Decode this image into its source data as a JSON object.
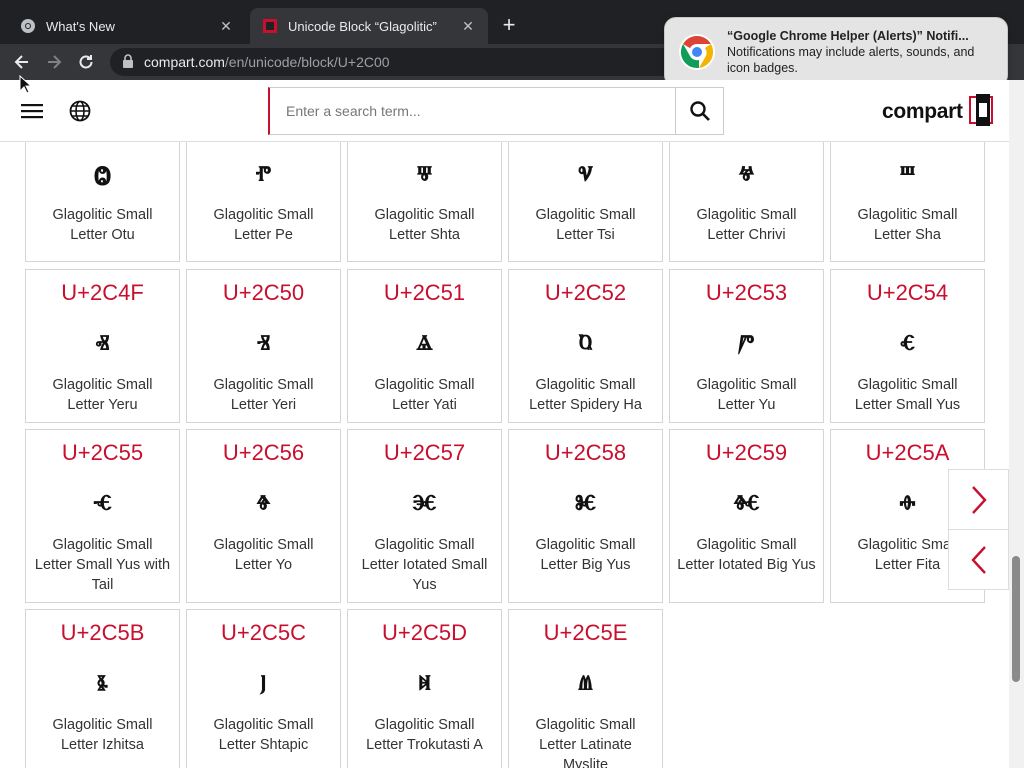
{
  "browser": {
    "tabs": [
      {
        "label": "What's New",
        "close": "✕"
      },
      {
        "label": "Unicode Block “Glagolitic”",
        "close": "✕"
      }
    ],
    "newtab": "+",
    "url_host": "compart.com",
    "url_path": "/en/unicode/block/U+2C00"
  },
  "notification": {
    "title": "“Google Chrome Helper (Alerts)” Notifi...",
    "body": "Notifications may include alerts, sounds, and icon badges."
  },
  "site": {
    "search_placeholder": "Enter a search term...",
    "logo_text": "compart"
  },
  "colors": {
    "accent": "#c8102e",
    "chrome_dark": "#202124",
    "chrome_toolbar": "#35363a"
  },
  "grid": {
    "row0": [
      {
        "code": "",
        "glyph": "Ⱉ",
        "name": "Glagolitic Small Letter Otu"
      },
      {
        "code": "",
        "glyph": "ⱂ",
        "name": "Glagolitic Small Letter Pe"
      },
      {
        "code": "",
        "glyph": "ⱋ",
        "name": "Glagolitic Small Letter Shta"
      },
      {
        "code": "",
        "glyph": "ⱌ",
        "name": "Glagolitic Small Letter Tsi"
      },
      {
        "code": "",
        "glyph": "ⱍ",
        "name": "Glagolitic Small Letter Chrivi"
      },
      {
        "code": "",
        "glyph": "ⱎ",
        "name": "Glagolitic Small Letter Sha"
      }
    ],
    "row1": [
      {
        "code": "U+2C4F",
        "glyph": "ⱏ",
        "name": "Glagolitic Small Letter Yeru"
      },
      {
        "code": "U+2C50",
        "glyph": "ⱐ",
        "name": "Glagolitic Small Letter Yeri"
      },
      {
        "code": "U+2C51",
        "glyph": "ⱑ",
        "name": "Glagolitic Small Letter Yati"
      },
      {
        "code": "U+2C52",
        "glyph": "ⱒ",
        "name": "Glagolitic Small Letter Spidery Ha"
      },
      {
        "code": "U+2C53",
        "glyph": "ⱓ",
        "name": "Glagolitic Small Letter Yu"
      },
      {
        "code": "U+2C54",
        "glyph": "ⱔ",
        "name": "Glagolitic Small Letter Small Yus"
      }
    ],
    "row2": [
      {
        "code": "U+2C55",
        "glyph": "ⱕ",
        "name": "Glagolitic Small Letter Small Yus with Tail"
      },
      {
        "code": "U+2C56",
        "glyph": "ⱖ",
        "name": "Glagolitic Small Letter Yo"
      },
      {
        "code": "U+2C57",
        "glyph": "ⱗ",
        "name": "Glagolitic Small Letter Iotated Small Yus"
      },
      {
        "code": "U+2C58",
        "glyph": "ⱘ",
        "name": "Glagolitic Small Letter Big Yus"
      },
      {
        "code": "U+2C59",
        "glyph": "ⱙ",
        "name": "Glagolitic Small Letter Iotated Big Yus"
      },
      {
        "code": "U+2C5A",
        "glyph": "ⱚ",
        "name": "Glagolitic Small Letter Fita"
      }
    ],
    "row3": [
      {
        "code": "U+2C5B",
        "glyph": "ⱛ",
        "name": "Glagolitic Small Letter Izhitsa"
      },
      {
        "code": "U+2C5C",
        "glyph": "ⱜ",
        "name": "Glagolitic Small Letter Shtapic"
      },
      {
        "code": "U+2C5D",
        "glyph": "ⱝ",
        "name": "Glagolitic Small Letter Trokutasti A"
      },
      {
        "code": "U+2C5E",
        "glyph": "ⱞ",
        "name": "Glagolitic Small Letter Latinate Myslite"
      }
    ]
  }
}
